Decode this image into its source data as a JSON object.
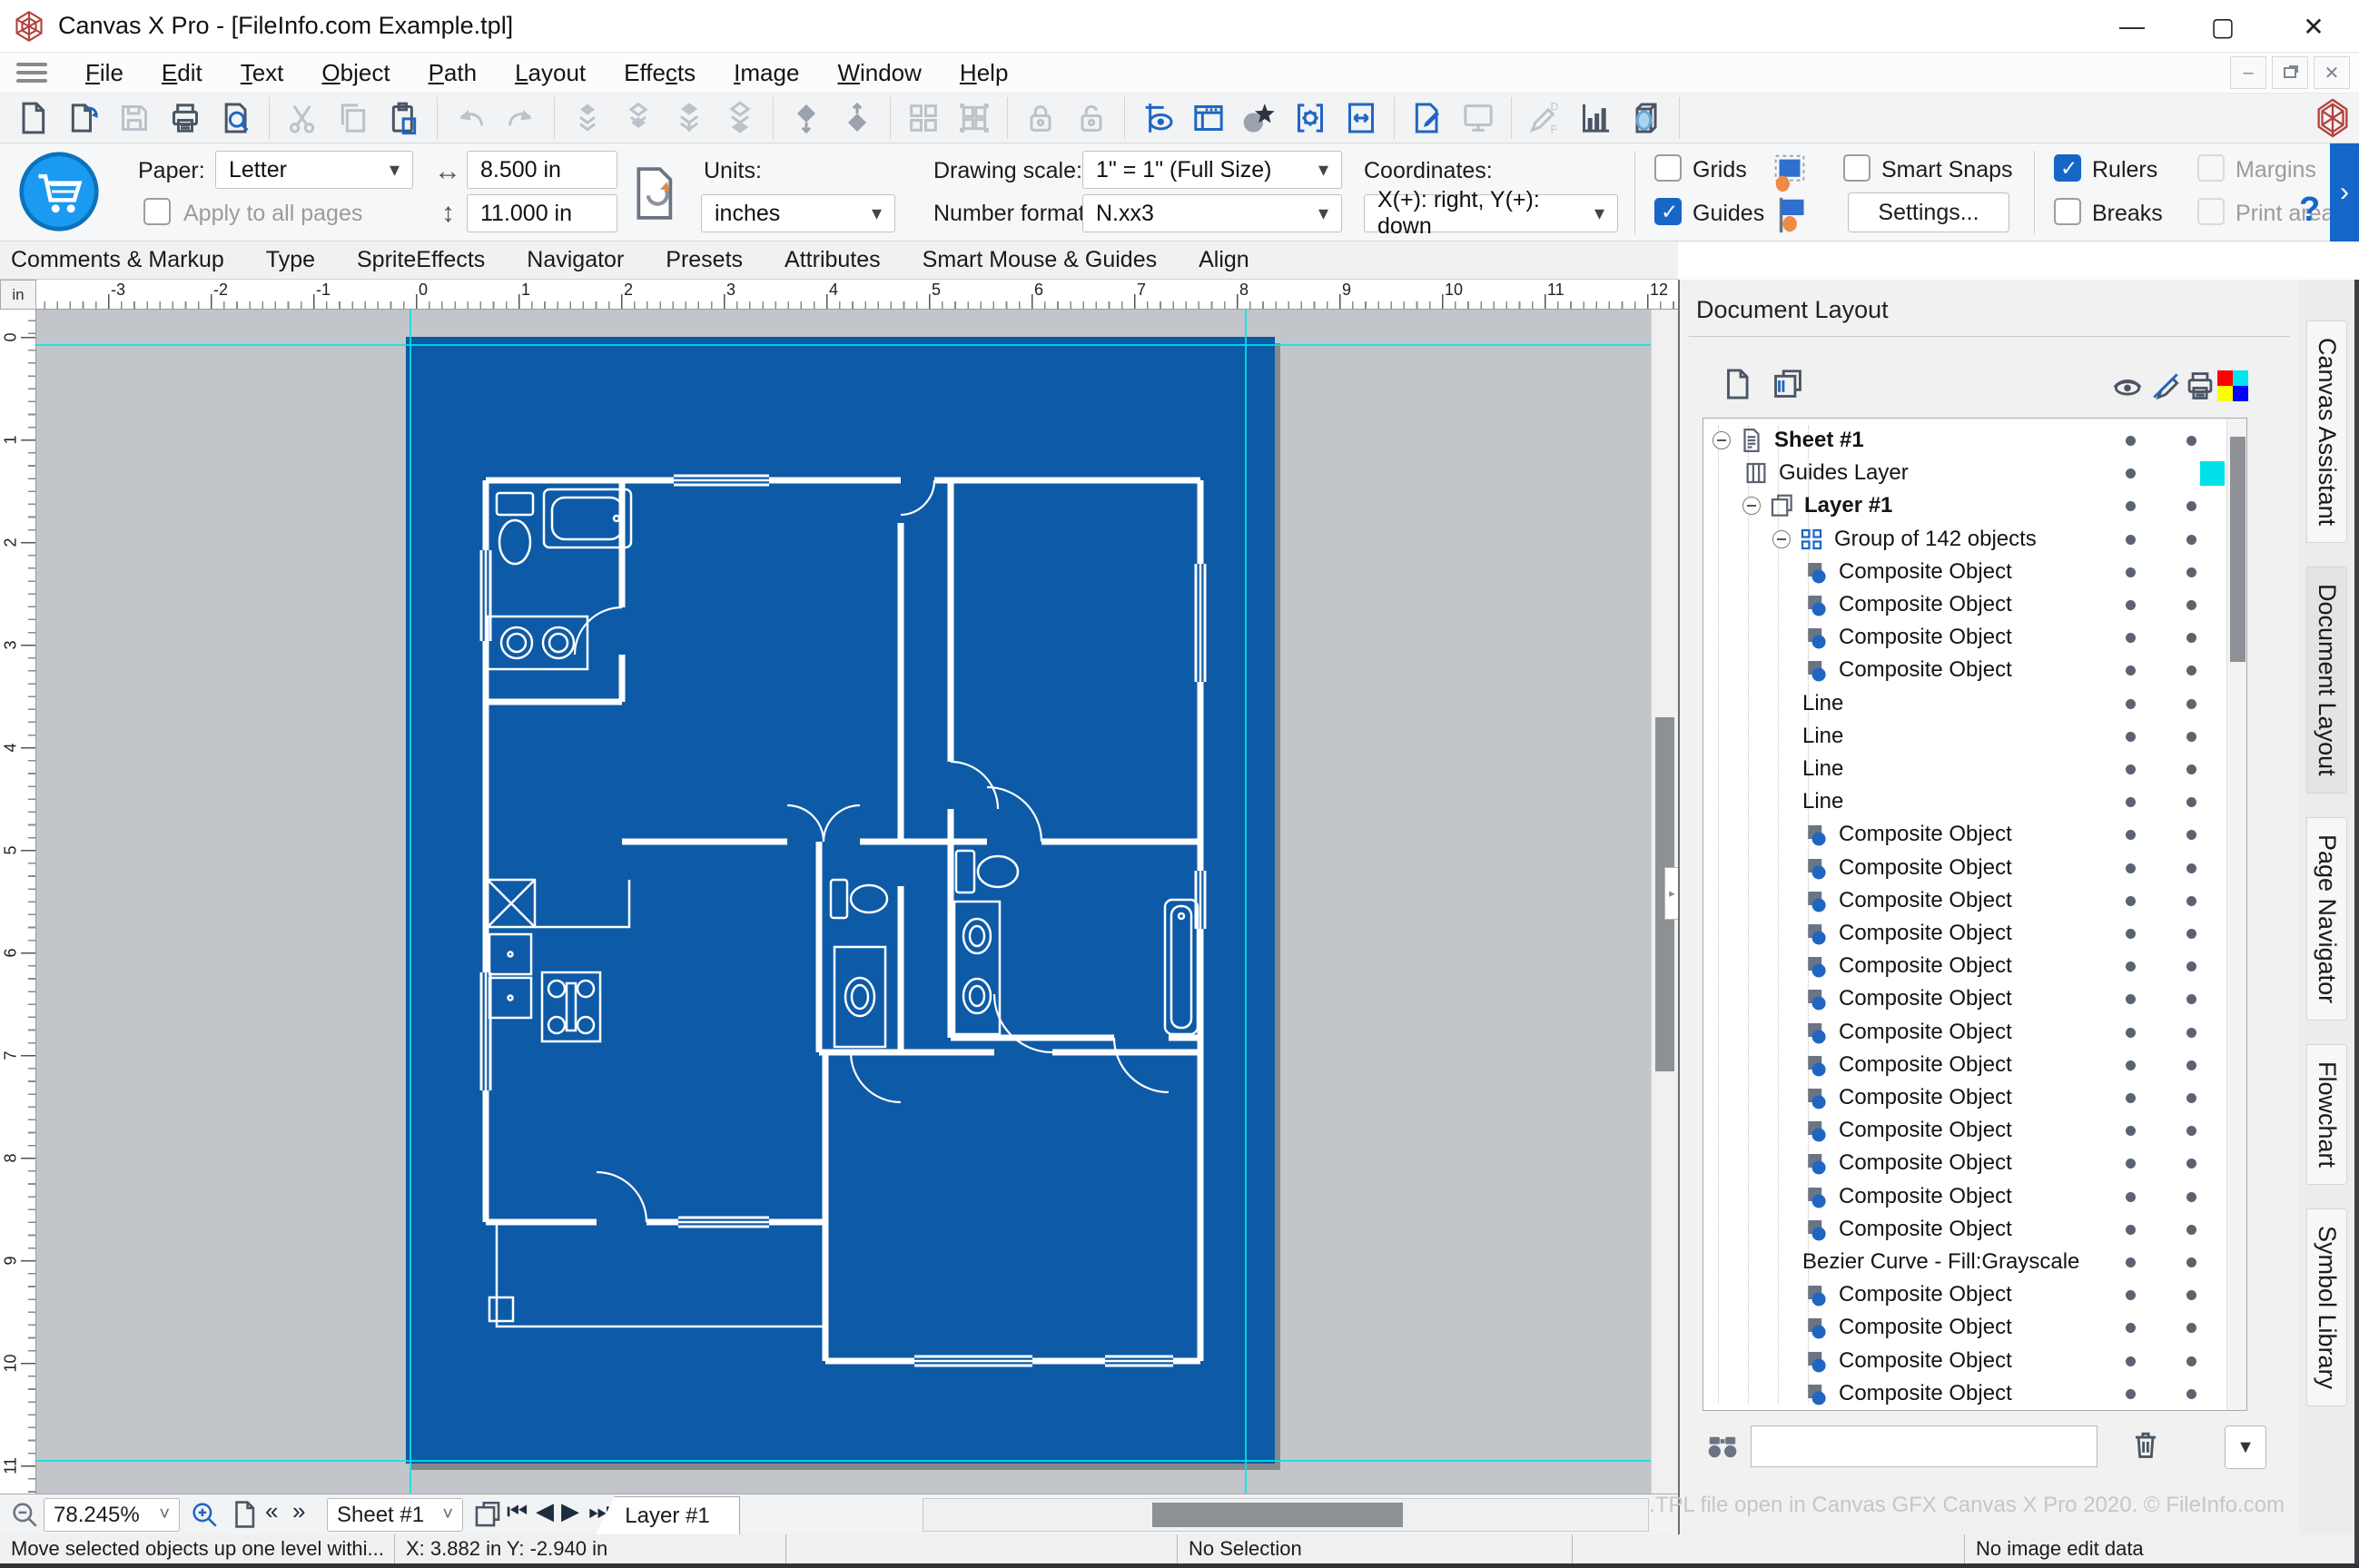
{
  "window": {
    "title": "Canvas X Pro - [FileInfo.com Example.tpl]"
  },
  "menu": {
    "items": [
      {
        "label": "File",
        "u": 0
      },
      {
        "label": "Edit",
        "u": 0
      },
      {
        "label": "Text",
        "u": 0
      },
      {
        "label": "Object",
        "u": 0
      },
      {
        "label": "Path",
        "u": 0
      },
      {
        "label": "Layout",
        "u": 0
      },
      {
        "label": "Effects",
        "u": 4
      },
      {
        "label": "Image",
        "u": 0
      },
      {
        "label": "Window",
        "u": 0
      },
      {
        "label": "Help",
        "u": 0
      }
    ]
  },
  "toolbar": {
    "groups": [
      [
        {
          "name": "new-document",
          "state": "normal"
        },
        {
          "name": "open-document",
          "state": "normal"
        },
        {
          "name": "save-document",
          "state": "disabled"
        },
        {
          "name": "print",
          "state": "normal"
        },
        {
          "name": "print-preview",
          "state": "normal"
        }
      ],
      [
        {
          "name": "cut",
          "state": "disabled"
        },
        {
          "name": "copy",
          "state": "disabled"
        },
        {
          "name": "paste",
          "state": "normal"
        }
      ],
      [
        {
          "name": "undo",
          "state": "disabled"
        },
        {
          "name": "redo",
          "state": "disabled"
        }
      ],
      [
        {
          "name": "bring-forward",
          "state": "disabled"
        },
        {
          "name": "send-backward",
          "state": "disabled"
        },
        {
          "name": "bring-to-front",
          "state": "disabled"
        },
        {
          "name": "send-to-back",
          "state": "disabled"
        }
      ],
      [
        {
          "name": "move-up-one-level",
          "state": "mid"
        },
        {
          "name": "move-down-one-level",
          "state": "mid"
        }
      ],
      [
        {
          "name": "group-objects",
          "state": "disabled"
        },
        {
          "name": "ungroup-objects",
          "state": "disabled"
        }
      ],
      [
        {
          "name": "lock",
          "state": "disabled"
        },
        {
          "name": "unlock",
          "state": "disabled"
        }
      ],
      [
        {
          "name": "visibility-tool",
          "state": "accent"
        },
        {
          "name": "panel-window",
          "state": "accent"
        },
        {
          "name": "sprite-effects",
          "state": "normal"
        },
        {
          "name": "object-properties",
          "state": "accent"
        },
        {
          "name": "resize-tool",
          "state": "accent"
        }
      ],
      [
        {
          "name": "annotate",
          "state": "accent"
        },
        {
          "name": "presentation",
          "state": "disabled"
        }
      ],
      [
        {
          "name": "data-pen",
          "state": "disabled"
        },
        {
          "name": "chart-tool",
          "state": "normal"
        },
        {
          "name": "lens-3d",
          "state": "normal"
        }
      ]
    ]
  },
  "properties": {
    "paper_label": "Paper:",
    "paper_value": "Letter",
    "width_value": "8.500 in",
    "height_value": "11.000 in",
    "apply_all_label": "Apply to all pages",
    "units_label": "Units:",
    "units_value": "inches",
    "drawing_scale_label": "Drawing scale:",
    "drawing_scale_value": "1\" = 1\"  (Full Size)",
    "number_format_label": "Number format:",
    "number_format_value": "N.xx3",
    "coordinates_label": "Coordinates:",
    "coordinates_value": "X(+): right, Y(+): down",
    "grids_label": "Grids",
    "guides_label": "Guides",
    "smart_snaps_label": "Smart Snaps",
    "settings_label": "Settings...",
    "rulers_label": "Rulers",
    "breaks_label": "Breaks",
    "margins_label": "Margins",
    "print_area_label": "Print area",
    "help_label": "?"
  },
  "doc_tabs": [
    "Comments & Markup",
    "Type",
    "SpriteEffects",
    "Navigator",
    "Presets",
    "Attributes",
    "Smart Mouse & Guides",
    "Align"
  ],
  "rulers": {
    "unit": "in",
    "h_numbers": [
      -3,
      -2,
      -1,
      0,
      1,
      2,
      3,
      4,
      5,
      6,
      7,
      8,
      9,
      10,
      11,
      12
    ],
    "v_numbers": [
      0,
      1,
      2,
      3,
      4,
      5,
      6,
      7,
      8,
      9,
      10,
      11
    ]
  },
  "panel": {
    "title": "Document Layout",
    "tree": [
      {
        "label": "Sheet #1",
        "depth": 0,
        "icon": "sheet",
        "bold": true,
        "expander": true,
        "dots": 2
      },
      {
        "label": "Guides Layer",
        "depth": 1,
        "icon": "guides",
        "bold": false,
        "expander": false,
        "dots": 1,
        "swatch": "#00e0e8"
      },
      {
        "label": "Layer #1",
        "depth": 1,
        "icon": "layer",
        "bold": true,
        "expander": true,
        "dots": 2
      },
      {
        "label": "Group of 142 objects",
        "depth": 2,
        "icon": "group",
        "bold": false,
        "expander": true,
        "dots": 2
      },
      {
        "label": "Composite Object",
        "depth": 3,
        "icon": "composite",
        "dots": 2
      },
      {
        "label": "Composite Object",
        "depth": 3,
        "icon": "composite",
        "dots": 2
      },
      {
        "label": "Composite Object",
        "depth": 3,
        "icon": "composite",
        "dots": 2
      },
      {
        "label": "Composite Object",
        "depth": 3,
        "icon": "composite",
        "dots": 2
      },
      {
        "label": "Line",
        "depth": 3,
        "icon": "none",
        "dots": 2
      },
      {
        "label": "Line",
        "depth": 3,
        "icon": "none",
        "dots": 2
      },
      {
        "label": "Line",
        "depth": 3,
        "icon": "none",
        "dots": 2
      },
      {
        "label": "Line",
        "depth": 3,
        "icon": "none",
        "dots": 2
      },
      {
        "label": "Composite Object",
        "depth": 3,
        "icon": "composite",
        "dots": 2
      },
      {
        "label": "Composite Object",
        "depth": 3,
        "icon": "composite",
        "dots": 2
      },
      {
        "label": "Composite Object",
        "depth": 3,
        "icon": "composite",
        "dots": 2
      },
      {
        "label": "Composite Object",
        "depth": 3,
        "icon": "composite",
        "dots": 2
      },
      {
        "label": "Composite Object",
        "depth": 3,
        "icon": "composite",
        "dots": 2
      },
      {
        "label": "Composite Object",
        "depth": 3,
        "icon": "composite",
        "dots": 2
      },
      {
        "label": "Composite Object",
        "depth": 3,
        "icon": "composite",
        "dots": 2
      },
      {
        "label": "Composite Object",
        "depth": 3,
        "icon": "composite",
        "dots": 2
      },
      {
        "label": "Composite Object",
        "depth": 3,
        "icon": "composite",
        "dots": 2
      },
      {
        "label": "Composite Object",
        "depth": 3,
        "icon": "composite",
        "dots": 2
      },
      {
        "label": "Composite Object",
        "depth": 3,
        "icon": "composite",
        "dots": 2
      },
      {
        "label": "Composite Object",
        "depth": 3,
        "icon": "composite",
        "dots": 2
      },
      {
        "label": "Composite Object",
        "depth": 3,
        "icon": "composite",
        "dots": 2
      },
      {
        "label": "Bezier Curve - Fill:Grayscale",
        "depth": 3,
        "icon": "none",
        "dots": 2
      },
      {
        "label": "Composite Object",
        "depth": 3,
        "icon": "composite",
        "dots": 2
      },
      {
        "label": "Composite Object",
        "depth": 3,
        "icon": "composite",
        "dots": 2
      },
      {
        "label": "Composite Object",
        "depth": 3,
        "icon": "composite",
        "dots": 2
      },
      {
        "label": "Composite Object",
        "depth": 3,
        "icon": "composite",
        "dots": 2
      }
    ],
    "watermark": ".TPL file open in Canvas GFX Canvas X Pro 2020. © FileInfo.com",
    "guides_swatch_color": "#00e0e8",
    "color_grid": [
      "#ff0000",
      "#00e5ee",
      "#ffff00",
      "#0000ff"
    ]
  },
  "side_tabs": [
    {
      "label": "Canvas Assistant",
      "active": false
    },
    {
      "label": "Document Layout",
      "active": true
    },
    {
      "label": "Page Navigator",
      "active": false
    },
    {
      "label": "Flowchart",
      "active": false
    },
    {
      "label": "Symbol Library",
      "active": false
    }
  ],
  "bottom": {
    "zoom_value": "78.245%",
    "sheet_value": "Sheet #1",
    "layer_tab": "Layer #1"
  },
  "status": {
    "cells": [
      "Move selected objects up one level withi...",
      "X: 3.882 in Y: -2.940 in",
      "",
      "No Selection",
      "",
      "No image edit data"
    ]
  },
  "colors": {
    "page_blue": "#0d5aa7",
    "accent_blue": "#1f66c2",
    "guide_cyan": "#00e6e6",
    "canvas_gray": "#c2c6cb"
  }
}
